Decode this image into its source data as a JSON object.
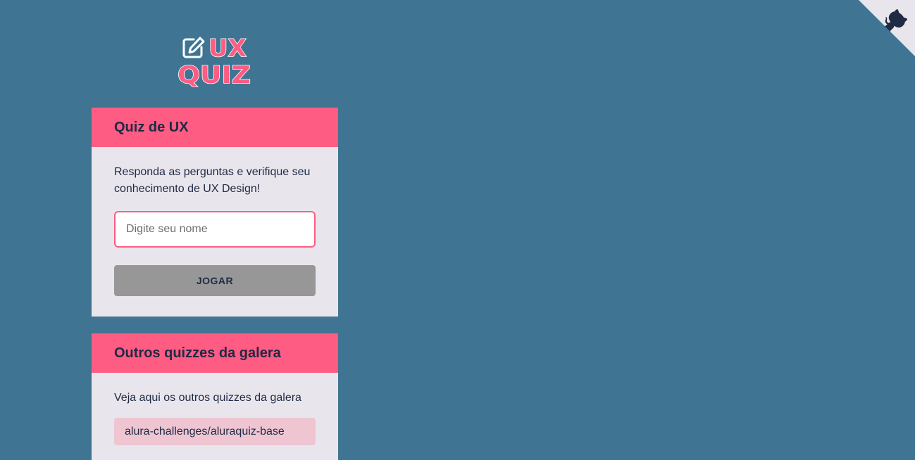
{
  "logo": {
    "line1": "UX",
    "line2": "QUIZ",
    "icon": "edit-icon",
    "color": "#ff5c83"
  },
  "main_widget": {
    "title": "Quiz de UX",
    "description": "Responda as perguntas e verifique seu conhecimento de UX Design!",
    "input_placeholder": "Digite seu nome",
    "input_value": "",
    "play_button_label": "JOGAR"
  },
  "others_widget": {
    "title": "Outros quizzes da galera",
    "description": "Veja aqui os outros quizzes da galera",
    "links": [
      "alura-challenges/aluraquiz-base"
    ]
  },
  "github_corner": {
    "icon": "github-octocat-icon"
  },
  "colors": {
    "background": "#3f7592",
    "accent": "#ff5c83",
    "card": "#e8e6ec",
    "text": "#1f2a44",
    "button_disabled": "#979797",
    "link_background": "#efc5d2"
  }
}
